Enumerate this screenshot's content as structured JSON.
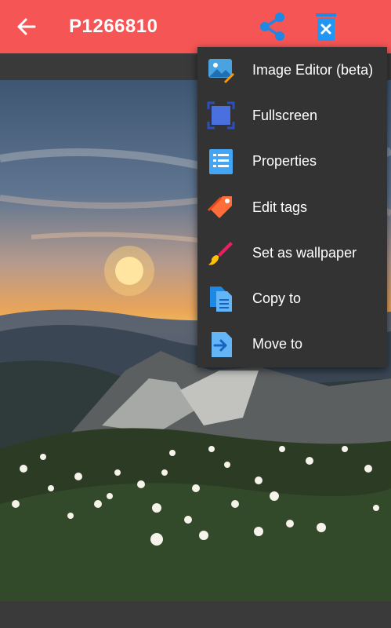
{
  "appbar": {
    "title": "P1266810",
    "back_icon": "arrow-left-icon",
    "share_icon": "share-icon",
    "delete_icon": "trash-icon",
    "color": "#f55555",
    "share_color": "#1e88e5"
  },
  "menu": {
    "items": [
      {
        "label": "Image Editor (beta)",
        "icon": "image-editor-icon"
      },
      {
        "label": "Fullscreen",
        "icon": "fullscreen-icon"
      },
      {
        "label": "Properties",
        "icon": "properties-icon"
      },
      {
        "label": "Edit tags",
        "icon": "tag-icon"
      },
      {
        "label": "Set as wallpaper",
        "icon": "brush-icon"
      },
      {
        "label": "Copy to",
        "icon": "copy-icon"
      },
      {
        "label": "Move to",
        "icon": "move-icon"
      }
    ]
  },
  "photo": {
    "subject": "mountain-sunset-wildflowers"
  }
}
